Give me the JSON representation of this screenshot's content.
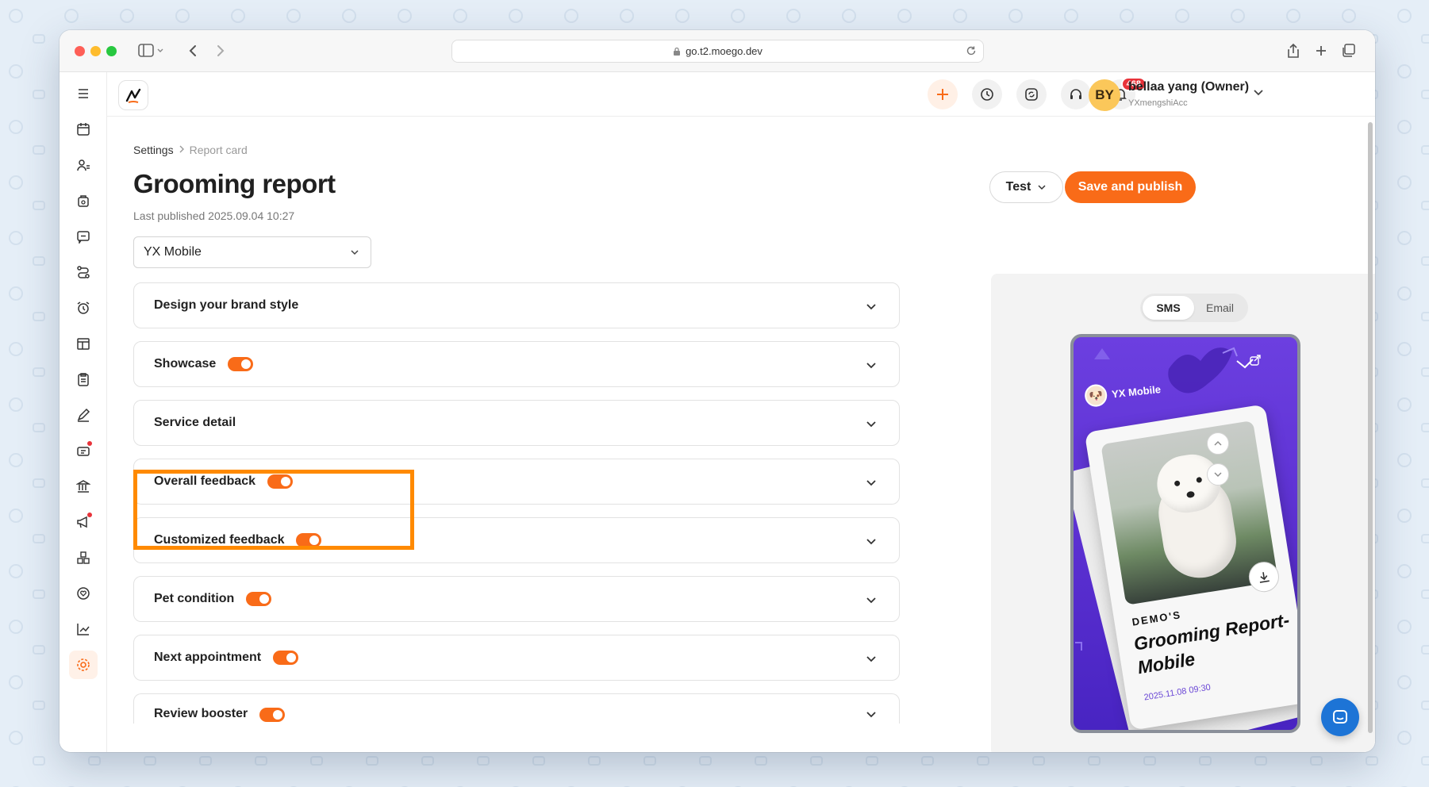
{
  "browser": {
    "url": "go.t2.moego.dev"
  },
  "topbar": {
    "notification_count": "468",
    "user_initials": "BY",
    "user_name": "bellaa yang (Owner)",
    "user_account": "YXmengshiAcc"
  },
  "breadcrumb": {
    "parent": "Settings",
    "current": "Report card"
  },
  "page": {
    "title": "Grooming report",
    "last_published": "Last published 2025.09.04 10:27"
  },
  "actions": {
    "test_label": "Test",
    "publish_label": "Save and publish"
  },
  "business_select": {
    "value": "YX Mobile"
  },
  "sections": [
    {
      "label": "Design your brand style",
      "toggle": false
    },
    {
      "label": "Showcase",
      "toggle": true,
      "enabled": true
    },
    {
      "label": "Service detail",
      "toggle": false
    },
    {
      "label": "Overall feedback",
      "toggle": true,
      "enabled": true
    },
    {
      "label": "Customized feedback",
      "toggle": true,
      "enabled": true
    },
    {
      "label": "Pet condition",
      "toggle": true,
      "enabled": true
    },
    {
      "label": "Next appointment",
      "toggle": true,
      "enabled": true
    },
    {
      "label": "Review booster",
      "toggle": true,
      "enabled": true
    }
  ],
  "preview": {
    "tabs": [
      "SMS",
      "Email"
    ],
    "active_tab": "SMS",
    "brand_name": "YX Mobile",
    "card_small": "DEMO'S",
    "card_title": "Grooming Report-Mobile",
    "card_date": "2025.11.08 09:30"
  },
  "colors": {
    "accent": "#f96b18",
    "highlight": "#ff8a00",
    "preview_purple": "#5a2fd0"
  }
}
